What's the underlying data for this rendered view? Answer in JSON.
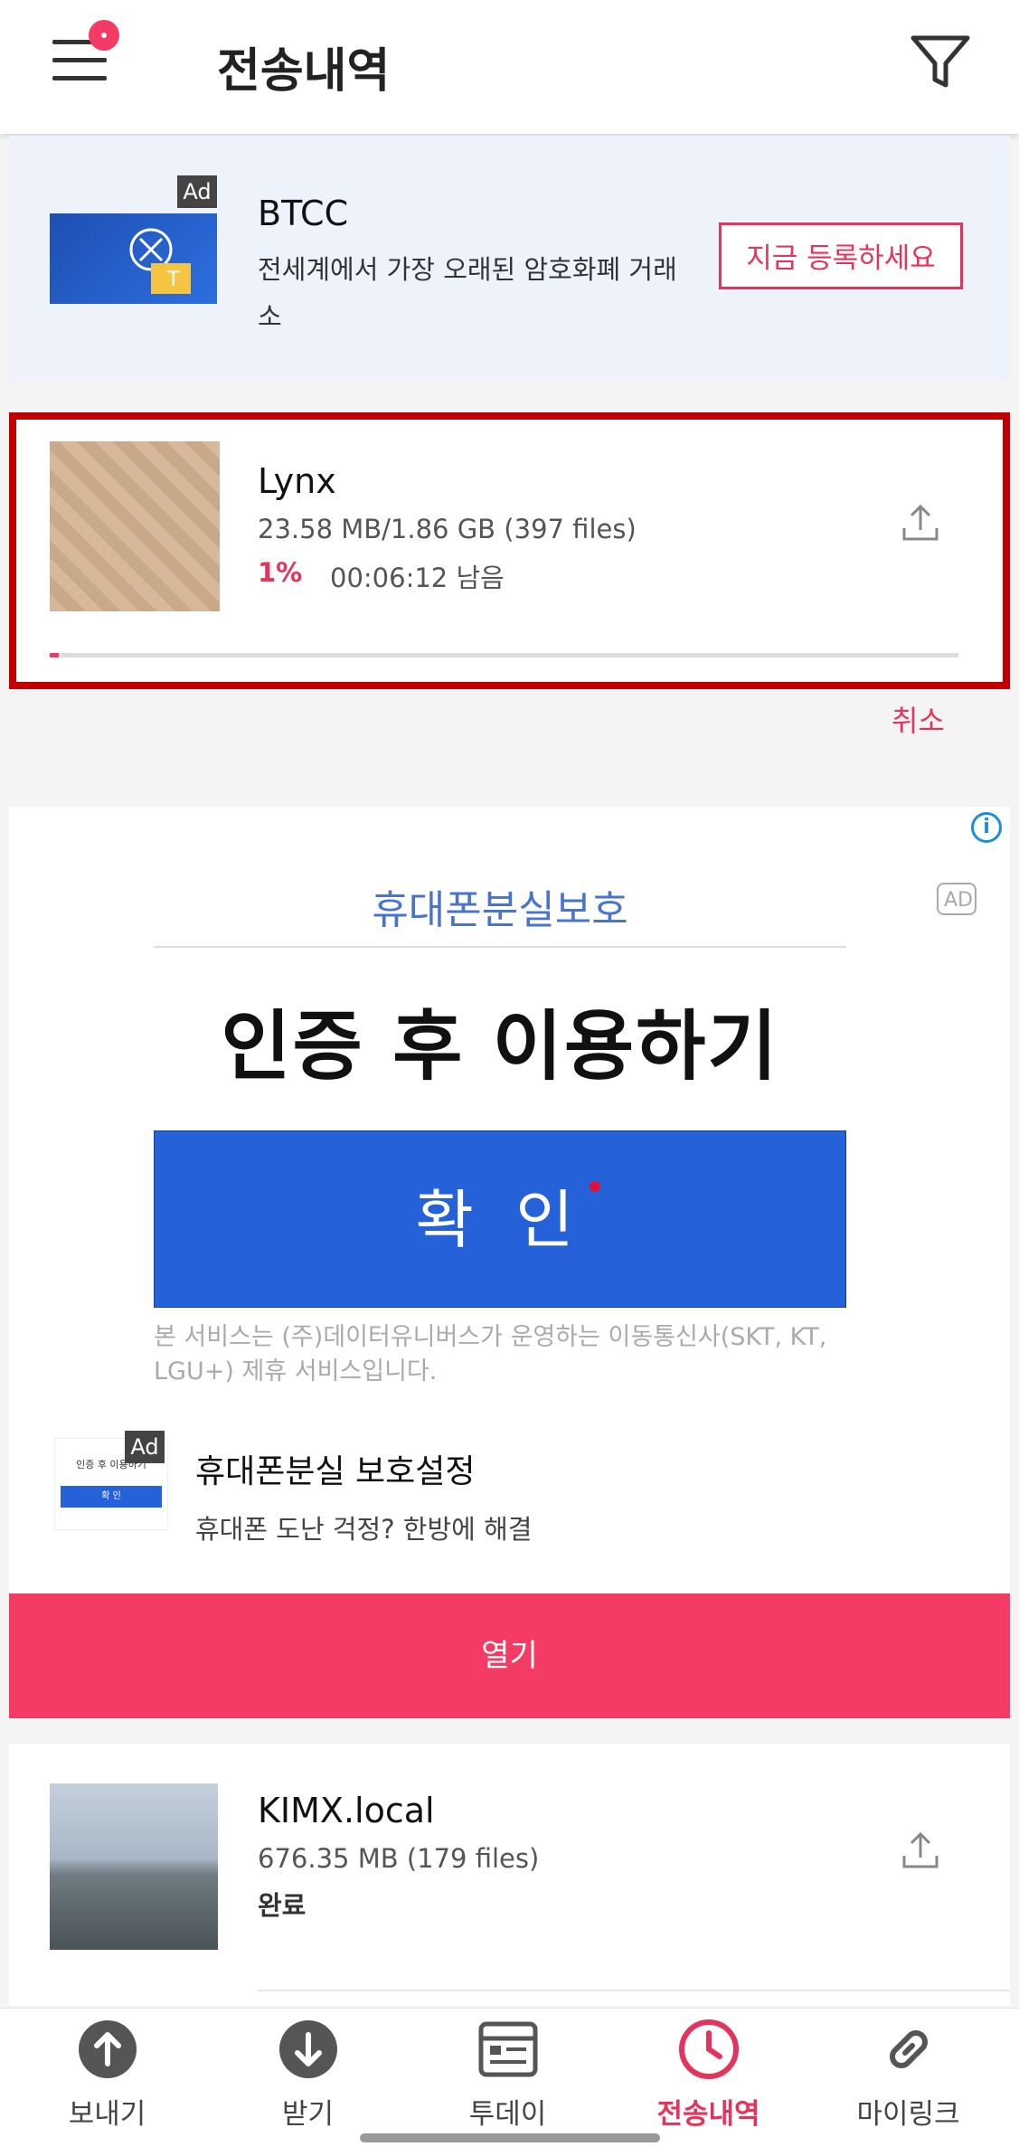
{
  "header": {
    "title": "전송내역"
  },
  "ad_top": {
    "badge": "Ad",
    "title": "BTCC",
    "description": "전세계에서 가장 오래된 암호화폐 거래소",
    "cta": "지금 등록하세요"
  },
  "transfer_active": {
    "name": "Lynx",
    "size": "23.58 MB/1.86 GB (397 files)",
    "percent": "1%",
    "remaining": "00:06:12 남음",
    "progress": 0.01,
    "cancel_label": "취소"
  },
  "ad_banner": {
    "header": "휴대폰분실보호",
    "headline": "인증 후 이용하기",
    "button": "확 인",
    "note": "본 서비스는 (주)데이터유니버스가 운영하는 이동통신사(SKT, KT, LGU+) 제휴 서비스입니다.",
    "corner": "AD",
    "badge": "Ad",
    "title": "휴대폰분실 보호설정",
    "description": "휴대폰 도난 걱정? 한방에 해결",
    "open_label": "열기",
    "thumb_title": "인증 후 이용하기",
    "thumb_button": "확 인"
  },
  "transfer_done": {
    "name": "KIMX.local",
    "size": "676.35 MB (179 files)",
    "status": "완료"
  },
  "nav": {
    "items": [
      {
        "label": "보내기",
        "icon": "upload-circle-icon"
      },
      {
        "label": "받기",
        "icon": "download-circle-icon"
      },
      {
        "label": "투데이",
        "icon": "today-icon"
      },
      {
        "label": "전송내역",
        "icon": "clock-icon",
        "active": true
      },
      {
        "label": "마이링크",
        "icon": "link-icon"
      }
    ]
  },
  "colors": {
    "accent": "#f33b63",
    "progress_track": "#dddddd",
    "banner_blue": "#2561d8"
  }
}
